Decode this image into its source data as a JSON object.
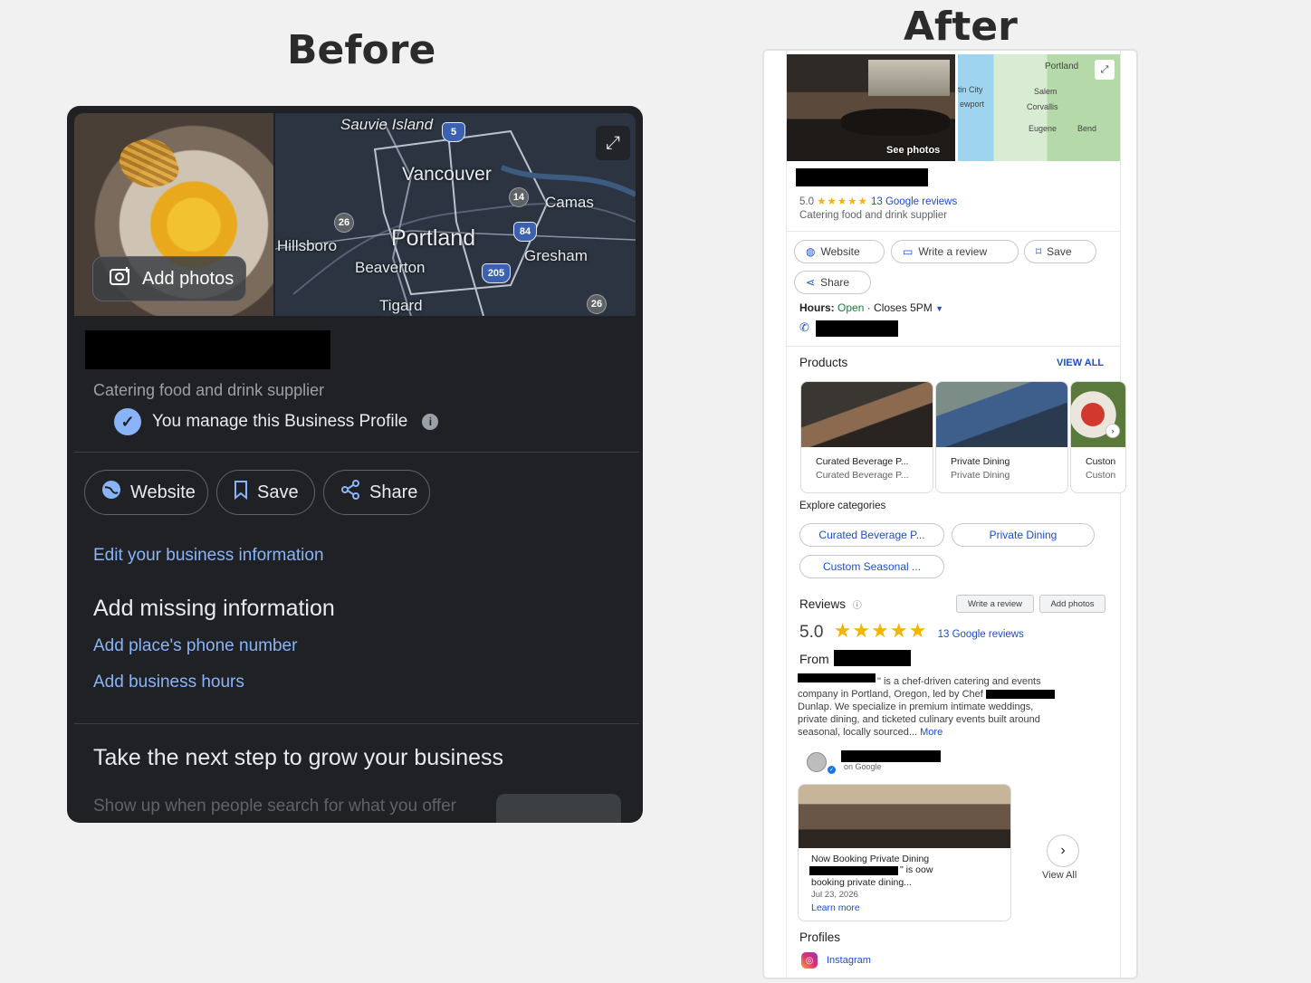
{
  "before": {
    "heading": "Before",
    "add_photos": "Add photos",
    "map_labels": {
      "sauvie": "Sauvie Island",
      "vancouver": "Vancouver",
      "camas": "Camas",
      "hillsboro": "Hillsboro",
      "portland": "Portland",
      "beaverton": "Beaverton",
      "gresham": "Gresham",
      "tigard": "Tigard"
    },
    "map_shields": {
      "i5": "5",
      "r14": "14",
      "r26a": "26",
      "i84": "84",
      "i205": "205",
      "r26b": "26"
    },
    "category": "Catering food and drink supplier",
    "manage_text": "You manage this Business Profile",
    "actions": {
      "website": "Website",
      "save": "Save",
      "share": "Share"
    },
    "edit_link": "Edit your business information",
    "missing_heading": "Add missing information",
    "add_phone": "Add place's phone number",
    "add_hours": "Add business hours",
    "grow_heading": "Take the next step to grow your business",
    "grow_sub": "Show up when people search for what you offer"
  },
  "after": {
    "heading": "After",
    "see_photos": "See photos",
    "map_labels": {
      "portland": "Portland",
      "city": "tin City",
      "salem": "Salem",
      "newport": "ewport",
      "corvallis": "Corvallis",
      "eugene": "Eugene",
      "bend": "Bend"
    },
    "rating": "5.0",
    "stars": "★★★★★",
    "reviews_link": "13 Google reviews",
    "category": "Catering food and drink supplier",
    "actions": {
      "website": "Website",
      "write_review": "Write a review",
      "save": "Save",
      "share": "Share"
    },
    "hours_label": "Hours:",
    "hours_open": "Open",
    "hours_close": "· Closes 5PM",
    "products_heading": "Products",
    "view_all": "VIEW ALL",
    "products": [
      {
        "title": "Curated Beverage P...",
        "sub": "Curated Beverage P..."
      },
      {
        "title": "Private Dining",
        "sub": "Private Dining"
      },
      {
        "title": "Custon",
        "sub": "Custon"
      }
    ],
    "explore_heading": "Explore categories",
    "categories": [
      "Curated Beverage P...",
      "Private Dining",
      "Custom Seasonal ..."
    ],
    "reviews_heading": "Reviews",
    "write_review_btn": "Write a review",
    "add_photos_btn": "Add photos",
    "from_label": "From",
    "description": [
      "\" is a chef-driven catering and events",
      "company in Portland, Oregon, led by Chef",
      "Dunlap. We specialize in premium intimate weddings,",
      "private dining, and ticketed culinary events built around",
      "seasonal, locally sourced..."
    ],
    "more": "More",
    "on_google": "on Google",
    "post": {
      "title": "Now Booking Private Dining",
      "line2": "\" is oow",
      "line3": "booking private dining...",
      "date": "Jul 23, 2026",
      "learn_more": "Learn more"
    },
    "view_all_posts": "View All",
    "profiles_heading": "Profiles",
    "instagram": "Instagram"
  },
  "colors": {
    "dark_bg": "#202124",
    "link_dark": "#8ab4f8",
    "link_light": "#1a4fc9",
    "star": "#f4b400",
    "open": "#188038"
  },
  "icons": [
    "camera-plus-icon",
    "expand-icon",
    "verified-badge-icon",
    "info-icon",
    "globe-icon",
    "bookmark-icon",
    "share-icon",
    "pencil-icon",
    "phone-icon",
    "dropdown-icon",
    "chevron-right-icon",
    "instagram-icon"
  ]
}
